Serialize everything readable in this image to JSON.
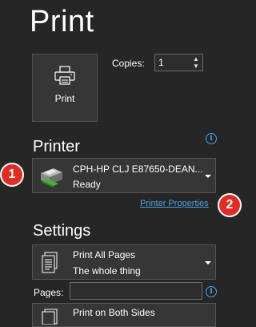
{
  "page_title": "Print",
  "print_button": {
    "label": "Print"
  },
  "copies": {
    "label": "Copies:",
    "value": "1"
  },
  "printer": {
    "section_title": "Printer",
    "name": "CPH-HP CLJ E87650-DEAN...",
    "status": "Ready",
    "properties_link": "Printer Properties"
  },
  "settings": {
    "section_title": "Settings",
    "pages_option": {
      "title": "Print All Pages",
      "subtitle": "The whole thing"
    },
    "pages_field": {
      "label": "Pages:",
      "value": ""
    },
    "sides_option": {
      "title": "Print on Both Sides"
    }
  },
  "annotations": {
    "badge1": "1",
    "badge2": "2"
  },
  "icons": {
    "info": "info-icon",
    "printer": "printer-icon",
    "document": "document-icon"
  },
  "colors": {
    "background": "#262626",
    "accent_link": "#4aa3df",
    "badge": "#e02c24"
  }
}
